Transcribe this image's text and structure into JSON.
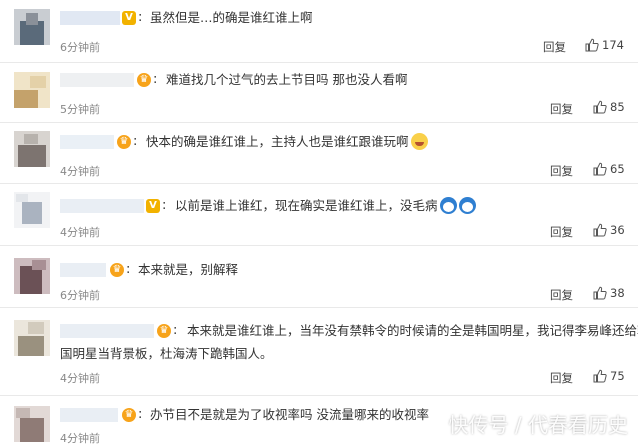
{
  "comments": [
    {
      "id": 1,
      "text": "虽然但是…的确是谁红谁上啊",
      "time": "6分钟前",
      "reply": "回复",
      "likes": "174",
      "badge": "V",
      "badge_type": "vip",
      "avatar_colors": [
        "#5a6a7a",
        "#c9cdd2",
        "#8a9099"
      ],
      "emoji": []
    },
    {
      "id": 2,
      "text": "难道找几个过气的去上节目吗 那也没人看啊",
      "time": "5分钟前",
      "reply": "回复",
      "likes": "85",
      "badge": "♛",
      "badge_type": "crown",
      "avatar_colors": [
        "#e4d1a8",
        "#c4a26b",
        "#f0e4c8"
      ],
      "emoji": []
    },
    {
      "id": 3,
      "text": "快本的确是谁红谁上，主持人也是谁红跟谁玩啊",
      "time": "4分钟前",
      "reply": "回复",
      "likes": "65",
      "badge": "♛",
      "badge_type": "crown",
      "avatar_colors": [
        "#b7b2ad",
        "#7d7470",
        "#d8d4d0"
      ],
      "emoji": [
        "laugh-emoji"
      ]
    },
    {
      "id": 4,
      "text": "以前是谁上谁红，现在确实是谁红谁上，没毛病",
      "time": "4分钟前",
      "reply": "回复",
      "likes": "36",
      "badge": "V",
      "badge_type": "vip",
      "avatar_colors": [
        "#e3e6ea",
        "#aab3c0",
        "#f2f3f5"
      ],
      "emoji": [
        "doraemon-emoji",
        "doraemon-emoji"
      ]
    },
    {
      "id": 5,
      "text": "本来就是，别解释",
      "time": "6分钟前",
      "reply": "回复",
      "likes": "38",
      "badge": "♛",
      "badge_type": "crown",
      "avatar_colors": [
        "#a88f94",
        "#6b5156",
        "#cdbcbf"
      ],
      "emoji": []
    },
    {
      "id": 6,
      "text": "本来就是谁红谁上，当年没有禁韩令的时候请的全是韩国明星，我记得李易峰还给韩",
      "text2": "国明星当背景板，杜海涛下跪韩国人。",
      "time": "4分钟前",
      "reply": "回复",
      "likes": "75",
      "badge": "♛",
      "badge_type": "crown",
      "avatar_colors": [
        "#d2cbbd",
        "#9a917f",
        "#ebe6dc"
      ],
      "emoji": []
    },
    {
      "id": 7,
      "text": "办节目不是就是为了收视率吗 没流量哪来的收视率",
      "time": "4分钟前",
      "reply": "回复",
      "likes": "",
      "badge": "♛",
      "badge_type": "crown",
      "avatar_colors": [
        "#c5b8b4",
        "#8f7b76",
        "#e2d9d6"
      ],
      "emoji": []
    }
  ],
  "watermark": "快传号 / 代春看历史",
  "icons": {
    "like": "thumbs-up-icon"
  }
}
